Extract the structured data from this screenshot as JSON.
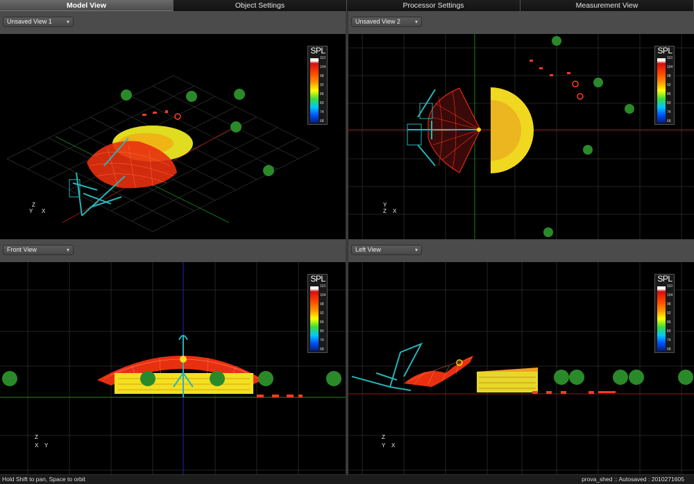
{
  "tabs": [
    {
      "label": "Model View",
      "active": true
    },
    {
      "label": "Object Settings",
      "active": false
    },
    {
      "label": "Processor Settings",
      "active": false
    },
    {
      "label": "Measurement View",
      "active": false
    }
  ],
  "views": {
    "top_left": {
      "selector": "Unsaved View 1"
    },
    "top_right": {
      "selector": "Unsaved View 2"
    },
    "bottom_left": {
      "selector": "Front View"
    },
    "bottom_right": {
      "selector": "Left View"
    }
  },
  "spl_legend": {
    "title": "SPL",
    "ticks": [
      "110",
      "104",
      "98",
      "92",
      "86",
      "80",
      "74",
      "68"
    ]
  },
  "axis": {
    "x": "X",
    "y": "Y",
    "z": "Z"
  },
  "status": {
    "hint": "Hold Shift to pan, Space to orbit",
    "info": "prova_shed :: Autosaved : 2010271605"
  },
  "colors": {
    "panel": "#4a4a4a",
    "viewport": "#000000",
    "grid": "#2e2e2e",
    "structure": "#27b5b9",
    "roof": "#ff3010",
    "floor": "#ffe000",
    "trees": "#9ed37a"
  }
}
